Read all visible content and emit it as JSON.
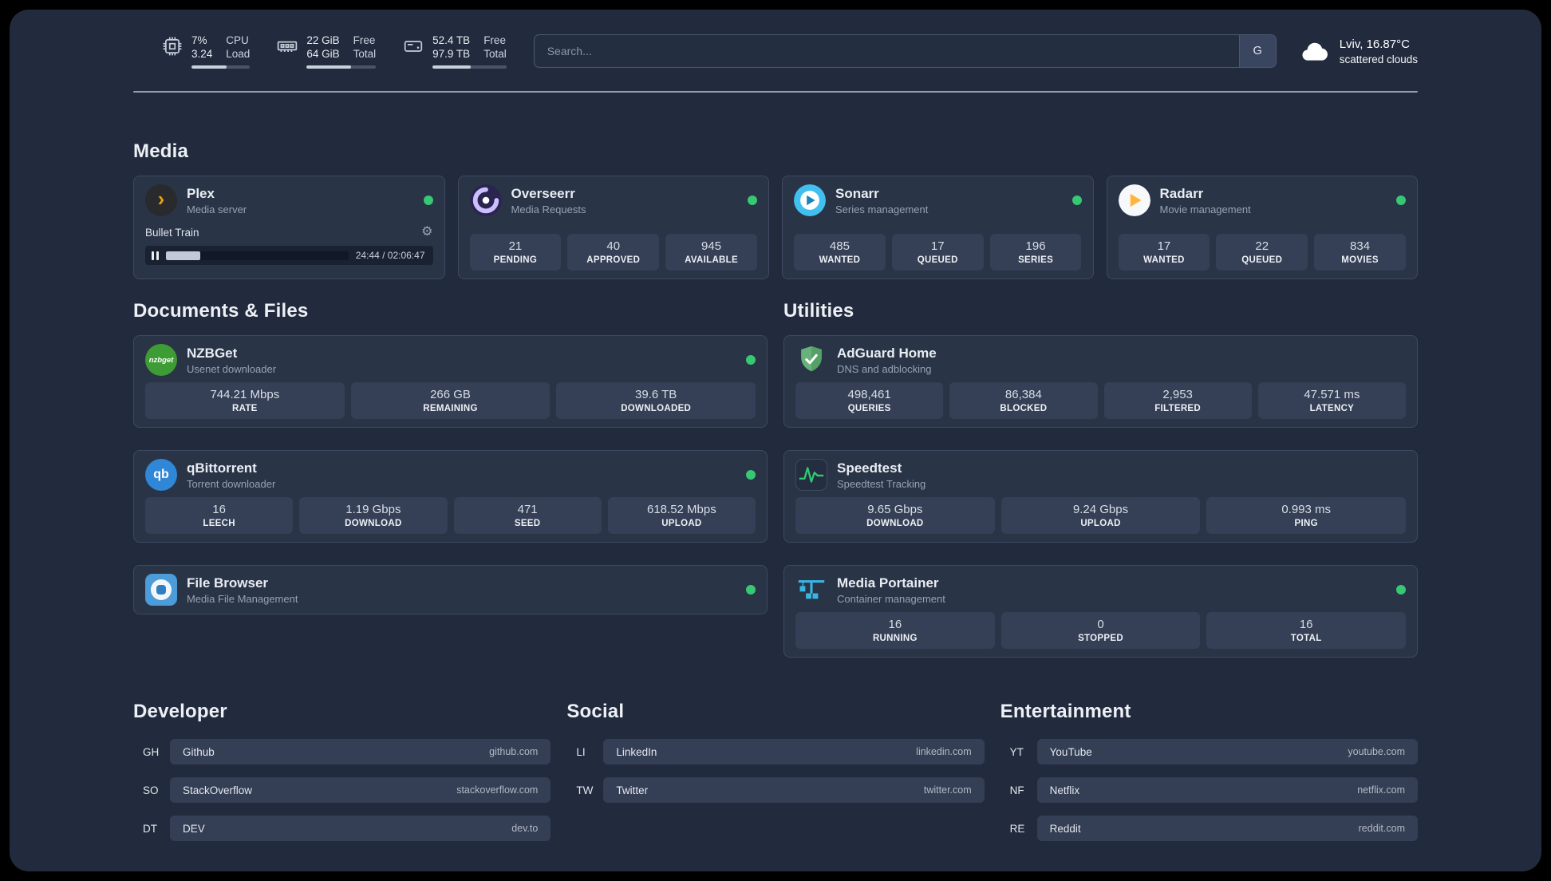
{
  "topbar": {
    "cpu": {
      "value1": "7%",
      "value2": "3.24",
      "label1": "CPU",
      "label2": "Load",
      "bar": "60%"
    },
    "ram": {
      "value1": "22 GiB",
      "value2": "64 GiB",
      "label1": "Free",
      "label2": "Total",
      "bar": "64%"
    },
    "disk": {
      "value1": "52.4 TB",
      "value2": "97.9 TB",
      "label1": "Free",
      "label2": "Total",
      "bar": "52%"
    },
    "search": {
      "placeholder": "Search...",
      "engine": "G"
    },
    "weather": {
      "location": "Lviv, 16.87°C",
      "condition": "scattered clouds"
    }
  },
  "media": {
    "heading": "Media",
    "plex": {
      "name": "Plex",
      "desc": "Media server",
      "now_playing": "Bullet Train",
      "time": "24:44 / 02:06:47",
      "progress": "19%"
    },
    "overseerr": {
      "name": "Overseerr",
      "desc": "Media Requests",
      "stats": [
        {
          "value": "21",
          "label": "PENDING"
        },
        {
          "value": "40",
          "label": "APPROVED"
        },
        {
          "value": "945",
          "label": "AVAILABLE"
        }
      ]
    },
    "sonarr": {
      "name": "Sonarr",
      "desc": "Series management",
      "stats": [
        {
          "value": "485",
          "label": "WANTED"
        },
        {
          "value": "17",
          "label": "QUEUED"
        },
        {
          "value": "196",
          "label": "SERIES"
        }
      ]
    },
    "radarr": {
      "name": "Radarr",
      "desc": "Movie management",
      "stats": [
        {
          "value": "17",
          "label": "WANTED"
        },
        {
          "value": "22",
          "label": "QUEUED"
        },
        {
          "value": "834",
          "label": "MOVIES"
        }
      ]
    }
  },
  "documents": {
    "heading": "Documents & Files",
    "nzbget": {
      "name": "NZBGet",
      "desc": "Usenet downloader",
      "stats": [
        {
          "value": "744.21 Mbps",
          "label": "RATE"
        },
        {
          "value": "266 GB",
          "label": "REMAINING"
        },
        {
          "value": "39.6 TB",
          "label": "DOWNLOADED"
        }
      ]
    },
    "qbittorrent": {
      "name": "qBittorrent",
      "desc": "Torrent downloader",
      "stats": [
        {
          "value": "16",
          "label": "LEECH"
        },
        {
          "value": "1.19 Gbps",
          "label": "DOWNLOAD"
        },
        {
          "value": "471",
          "label": "SEED"
        },
        {
          "value": "618.52 Mbps",
          "label": "UPLOAD"
        }
      ]
    },
    "filebrowser": {
      "name": "File Browser",
      "desc": "Media File Management"
    }
  },
  "utilities": {
    "heading": "Utilities",
    "adguard": {
      "name": "AdGuard Home",
      "desc": "DNS and adblocking",
      "stats": [
        {
          "value": "498,461",
          "label": "QUERIES"
        },
        {
          "value": "86,384",
          "label": "BLOCKED"
        },
        {
          "value": "2,953",
          "label": "FILTERED"
        },
        {
          "value": "47.571 ms",
          "label": "LATENCY"
        }
      ]
    },
    "speedtest": {
      "name": "Speedtest",
      "desc": "Speedtest Tracking",
      "stats": [
        {
          "value": "9.65 Gbps",
          "label": "DOWNLOAD"
        },
        {
          "value": "9.24 Gbps",
          "label": "UPLOAD"
        },
        {
          "value": "0.993 ms",
          "label": "PING"
        }
      ]
    },
    "portainer": {
      "name": "Media Portainer",
      "desc": "Container management",
      "stats": [
        {
          "value": "16",
          "label": "RUNNING"
        },
        {
          "value": "0",
          "label": "STOPPED"
        },
        {
          "value": "16",
          "label": "TOTAL"
        }
      ]
    }
  },
  "bookmarks": {
    "developer": {
      "heading": "Developer",
      "items": [
        {
          "abbr": "GH",
          "name": "Github",
          "url": "github.com"
        },
        {
          "abbr": "SO",
          "name": "StackOverflow",
          "url": "stackoverflow.com"
        },
        {
          "abbr": "DT",
          "name": "DEV",
          "url": "dev.to"
        }
      ]
    },
    "social": {
      "heading": "Social",
      "items": [
        {
          "abbr": "LI",
          "name": "LinkedIn",
          "url": "linkedin.com"
        },
        {
          "abbr": "TW",
          "name": "Twitter",
          "url": "twitter.com"
        }
      ]
    },
    "entertainment": {
      "heading": "Entertainment",
      "items": [
        {
          "abbr": "YT",
          "name": "YouTube",
          "url": "youtube.com"
        },
        {
          "abbr": "NF",
          "name": "Netflix",
          "url": "netflix.com"
        },
        {
          "abbr": "RE",
          "name": "Reddit",
          "url": "reddit.com"
        }
      ]
    }
  },
  "icons": {
    "plex_glyph": "›",
    "gear_glyph": "⚙",
    "nzbget_text": "nzbget",
    "qb_text": "qb"
  }
}
